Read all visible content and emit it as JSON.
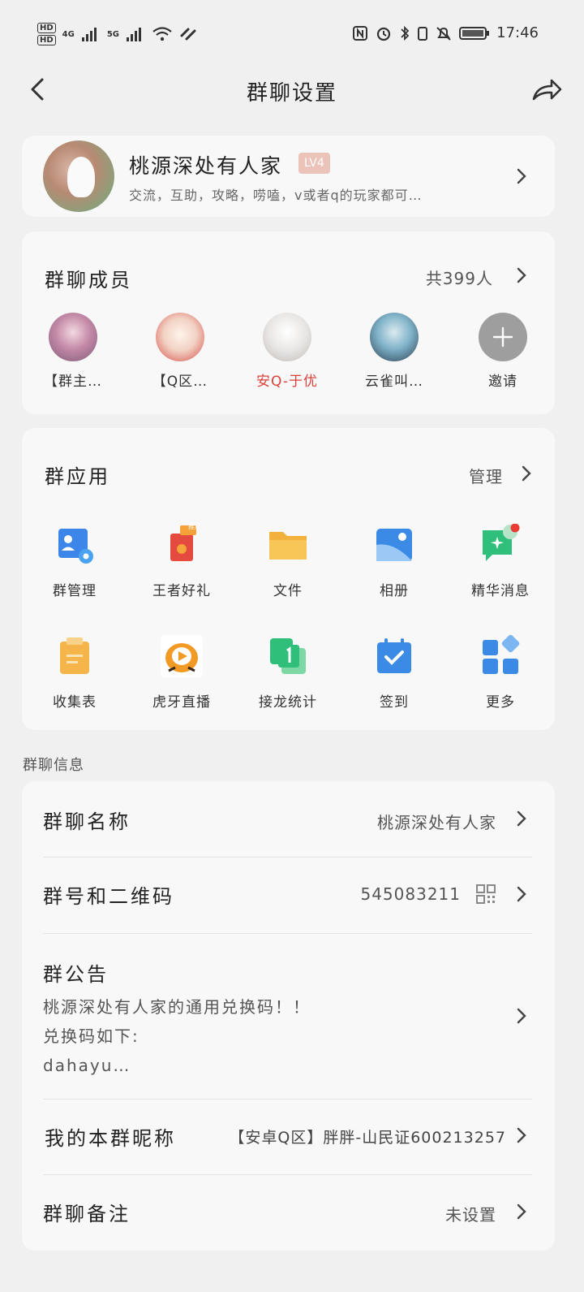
{
  "status_bar": {
    "hd1": "HD",
    "hd2": "HD",
    "net1": "4G",
    "net2": "5G",
    "time": "17:46"
  },
  "title_bar": {
    "title": "群聊设置"
  },
  "group": {
    "name": "桃源深处有人家",
    "level": "LV4",
    "description": "交流，互助，攻略，唠嗑，v或者q的玩家都可…"
  },
  "members": {
    "heading": "群聊成员",
    "count_text": "共399人",
    "list": [
      {
        "name": "【群主…",
        "highlight": false
      },
      {
        "name": "【Q区…",
        "highlight": false
      },
      {
        "name": "安Q-于优",
        "highlight": true
      },
      {
        "name": "云雀叫…",
        "highlight": false
      }
    ],
    "invite_label": "邀请"
  },
  "apps": {
    "heading": "群应用",
    "manage_label": "管理",
    "items": [
      {
        "label": "群管理",
        "icon": "group-admin-icon"
      },
      {
        "label": "王者好礼",
        "icon": "gift-icon"
      },
      {
        "label": "文件",
        "icon": "folder-icon"
      },
      {
        "label": "相册",
        "icon": "album-icon"
      },
      {
        "label": "精华消息",
        "icon": "essence-message-icon"
      },
      {
        "label": "收集表",
        "icon": "clipboard-icon"
      },
      {
        "label": "虎牙直播",
        "icon": "huya-live-icon"
      },
      {
        "label": "接龙统计",
        "icon": "relay-count-icon"
      },
      {
        "label": "签到",
        "icon": "checkin-calendar-icon"
      },
      {
        "label": "更多",
        "icon": "more-grid-icon"
      }
    ],
    "gift_badge": "推广"
  },
  "info": {
    "section_label": "群聊信息",
    "group_name_label": "群聊名称",
    "group_name_value": "桃源深处有人家",
    "group_id_label": "群号和二维码",
    "group_id_value": "545083211",
    "notice_label": "群公告",
    "notice_lines": [
      "桃源深处有人家的通用兑换码！！",
      "兑换码如下:",
      "dahayu…"
    ],
    "nickname_label": "我的本群昵称",
    "nickname_value": "【安卓Q区】胖胖-山民证600213257",
    "remark_label": "群聊备注",
    "remark_value": "未设置"
  }
}
